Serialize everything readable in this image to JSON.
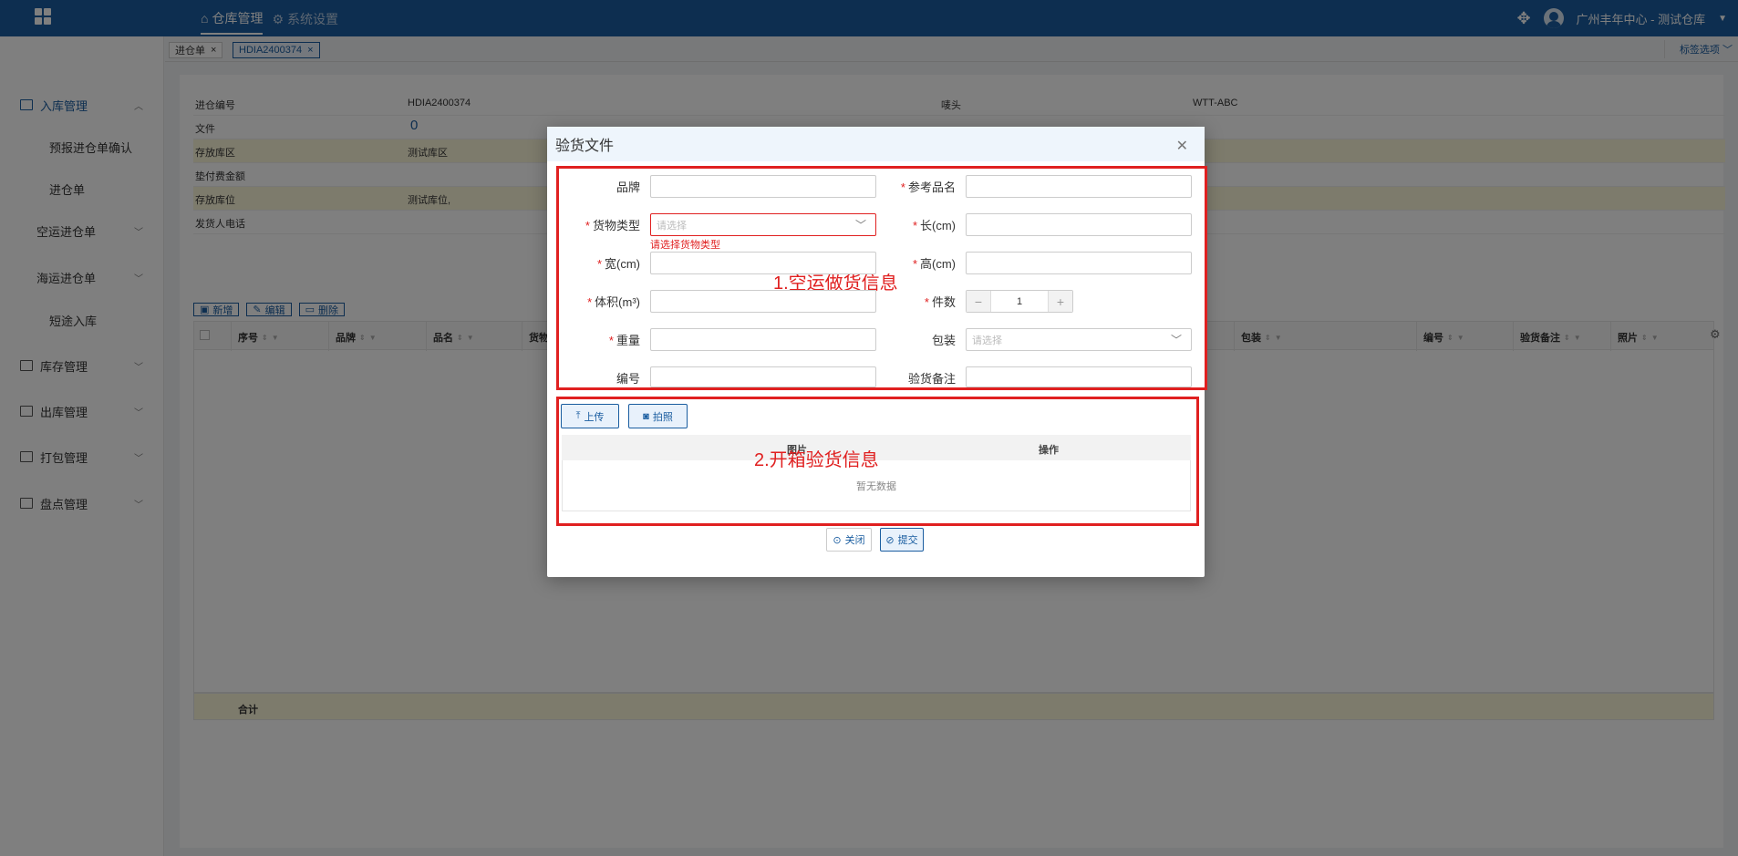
{
  "topbar": {
    "nav": [
      {
        "label": "仓库管理",
        "icon": "home-icon"
      },
      {
        "label": "系统设置",
        "icon": "gear-icon"
      }
    ],
    "user_label": "广州丰年中心 - 测试仓库"
  },
  "sidebar": {
    "groups": [
      {
        "label": "入库管理",
        "icon": "inbound-icon",
        "expanded": true
      },
      {
        "label": "空运进仓单",
        "icon": ""
      },
      {
        "label": "海运进仓单",
        "icon": ""
      },
      {
        "label": "库存管理",
        "icon": "inventory-icon"
      },
      {
        "label": "出库管理",
        "icon": "outbound-icon"
      },
      {
        "label": "打包管理",
        "icon": "package-icon"
      },
      {
        "label": "盘点管理",
        "icon": "stocktake-icon"
      }
    ],
    "subitems": [
      "预报进仓单确认",
      "进仓单",
      "短途入库"
    ]
  },
  "tabs": [
    {
      "label": "进仓单",
      "active": false
    },
    {
      "label": "HDIA2400374",
      "active": true
    }
  ],
  "tag_options": "标签选项",
  "info": {
    "rows": [
      {
        "label": "进仓编号",
        "value": "HDIA2400374",
        "label2": "唛头",
        "value2": "WTT-ABC"
      },
      {
        "label": "文件",
        "value": "0",
        "label2": "",
        "value2": ""
      },
      {
        "label": "存放库区",
        "value": "测试库区",
        "label2": "",
        "value2": ""
      },
      {
        "label": "垫付费金额",
        "value": "",
        "label2": "",
        "value2": ""
      },
      {
        "label": "存放库位",
        "value": "测试库位,",
        "label2": "",
        "value2": ""
      },
      {
        "label": "发货人电话",
        "value": "",
        "label2": "",
        "value2": ""
      }
    ]
  },
  "toolbar": {
    "add": "新增",
    "edit": "编辑",
    "delete": "删除"
  },
  "grid": {
    "columns": [
      "序号",
      "品牌",
      "品名",
      "货物",
      "包装",
      "编号",
      "验货备注",
      "照片"
    ],
    "total_label": "合计"
  },
  "modal": {
    "title": "验货文件",
    "annotation1": "1.空运做货信息",
    "annotation2": "2.开箱验货信息",
    "fields": {
      "brand": "品牌",
      "ref_name": "参考品名",
      "cargo_type": "货物类型",
      "cargo_type_placeholder": "请选择",
      "cargo_type_error": "请选择货物类型",
      "length": "长(cm)",
      "width": "宽(cm)",
      "height": "高(cm)",
      "volume": "体积(m³)",
      "pieces": "件数",
      "pieces_value": "1",
      "weight": "重量",
      "packaging": "包装",
      "packaging_placeholder": "请选择",
      "code": "编号",
      "inspection_note": "验货备注"
    },
    "upload": {
      "upload_label": "上传",
      "photo_label": "拍照",
      "col_image": "图片",
      "col_action": "操作",
      "empty": "暂无数据"
    },
    "footer": {
      "close": "关闭",
      "submit": "提交"
    }
  },
  "colors": {
    "brand": "#1a5da0",
    "error": "#e02020",
    "highlight": "#fbf6d9"
  }
}
